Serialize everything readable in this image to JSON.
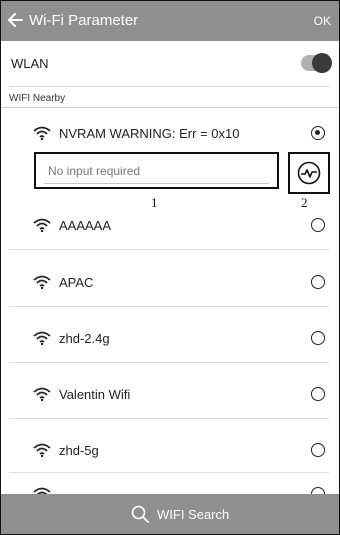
{
  "header": {
    "back_icon": "arrow-left-icon",
    "title": "Wi-Fi Parameter",
    "ok_label": "OK"
  },
  "wlan": {
    "label": "WLAN",
    "enabled": true
  },
  "section": {
    "label": "WIFI Nearby"
  },
  "networks": [
    {
      "ssid": "NVRAM WARNING: Err = 0x10",
      "selected": true
    },
    {
      "ssid": "AAAAAA",
      "selected": false
    },
    {
      "ssid": "APAC",
      "selected": false
    },
    {
      "ssid": "zhd-2.4g",
      "selected": false
    },
    {
      "ssid": "Valentin Wifi",
      "selected": false
    },
    {
      "ssid": "zhd-5g",
      "selected": false
    }
  ],
  "password": {
    "placeholder": "No input required",
    "value": ""
  },
  "callouts": {
    "one": "1",
    "two": "2"
  },
  "footer": {
    "search_icon": "search-icon",
    "label": "WIFI Search"
  },
  "colors": {
    "bar": "#8f8f8f",
    "text": "#222222",
    "toggle_knob": "#3a3a3a"
  }
}
